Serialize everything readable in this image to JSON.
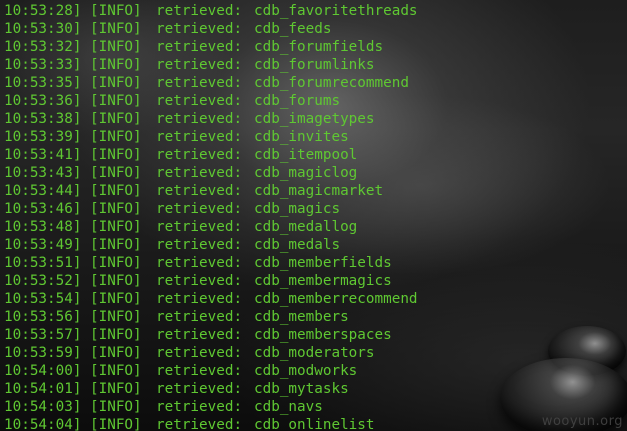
{
  "terminal": {
    "text_color": "#5fc832",
    "watermark": "wooyun.org",
    "lines": [
      {
        "time": "10:53:28]",
        "level": "[INFO]",
        "verb": "retrieved:",
        "table": "cdb_favoritethreads"
      },
      {
        "time": "10:53:30]",
        "level": "[INFO]",
        "verb": "retrieved:",
        "table": "cdb_feeds"
      },
      {
        "time": "10:53:32]",
        "level": "[INFO]",
        "verb": "retrieved:",
        "table": "cdb_forumfields"
      },
      {
        "time": "10:53:33]",
        "level": "[INFO]",
        "verb": "retrieved:",
        "table": "cdb_forumlinks"
      },
      {
        "time": "10:53:35]",
        "level": "[INFO]",
        "verb": "retrieved:",
        "table": "cdb_forumrecommend"
      },
      {
        "time": "10:53:36]",
        "level": "[INFO]",
        "verb": "retrieved:",
        "table": "cdb_forums"
      },
      {
        "time": "10:53:38]",
        "level": "[INFO]",
        "verb": "retrieved:",
        "table": "cdb_imagetypes"
      },
      {
        "time": "10:53:39]",
        "level": "[INFO]",
        "verb": "retrieved:",
        "table": "cdb_invites"
      },
      {
        "time": "10:53:41]",
        "level": "[INFO]",
        "verb": "retrieved:",
        "table": "cdb_itempool"
      },
      {
        "time": "10:53:43]",
        "level": "[INFO]",
        "verb": "retrieved:",
        "table": "cdb_magiclog"
      },
      {
        "time": "10:53:44]",
        "level": "[INFO]",
        "verb": "retrieved:",
        "table": "cdb_magicmarket"
      },
      {
        "time": "10:53:46]",
        "level": "[INFO]",
        "verb": "retrieved:",
        "table": "cdb_magics"
      },
      {
        "time": "10:53:48]",
        "level": "[INFO]",
        "verb": "retrieved:",
        "table": "cdb_medallog"
      },
      {
        "time": "10:53:49]",
        "level": "[INFO]",
        "verb": "retrieved:",
        "table": "cdb_medals"
      },
      {
        "time": "10:53:51]",
        "level": "[INFO]",
        "verb": "retrieved:",
        "table": "cdb_memberfields"
      },
      {
        "time": "10:53:52]",
        "level": "[INFO]",
        "verb": "retrieved:",
        "table": "cdb_membermagics"
      },
      {
        "time": "10:53:54]",
        "level": "[INFO]",
        "verb": "retrieved:",
        "table": "cdb_memberrecommend"
      },
      {
        "time": "10:53:56]",
        "level": "[INFO]",
        "verb": "retrieved:",
        "table": "cdb_members"
      },
      {
        "time": "10:53:57]",
        "level": "[INFO]",
        "verb": "retrieved:",
        "table": "cdb_memberspaces"
      },
      {
        "time": "10:53:59]",
        "level": "[INFO]",
        "verb": "retrieved:",
        "table": "cdb_moderators"
      },
      {
        "time": "10:54:00]",
        "level": "[INFO]",
        "verb": "retrieved:",
        "table": "cdb_modworks"
      },
      {
        "time": "10:54:01]",
        "level": "[INFO]",
        "verb": "retrieved:",
        "table": "cdb_mytasks"
      },
      {
        "time": "10:54:03]",
        "level": "[INFO]",
        "verb": "retrieved:",
        "table": "cdb_navs"
      },
      {
        "time": "10:54:04]",
        "level": "[INFO]",
        "verb": "retrieved:",
        "table": "cdb_onlinelist"
      }
    ]
  }
}
